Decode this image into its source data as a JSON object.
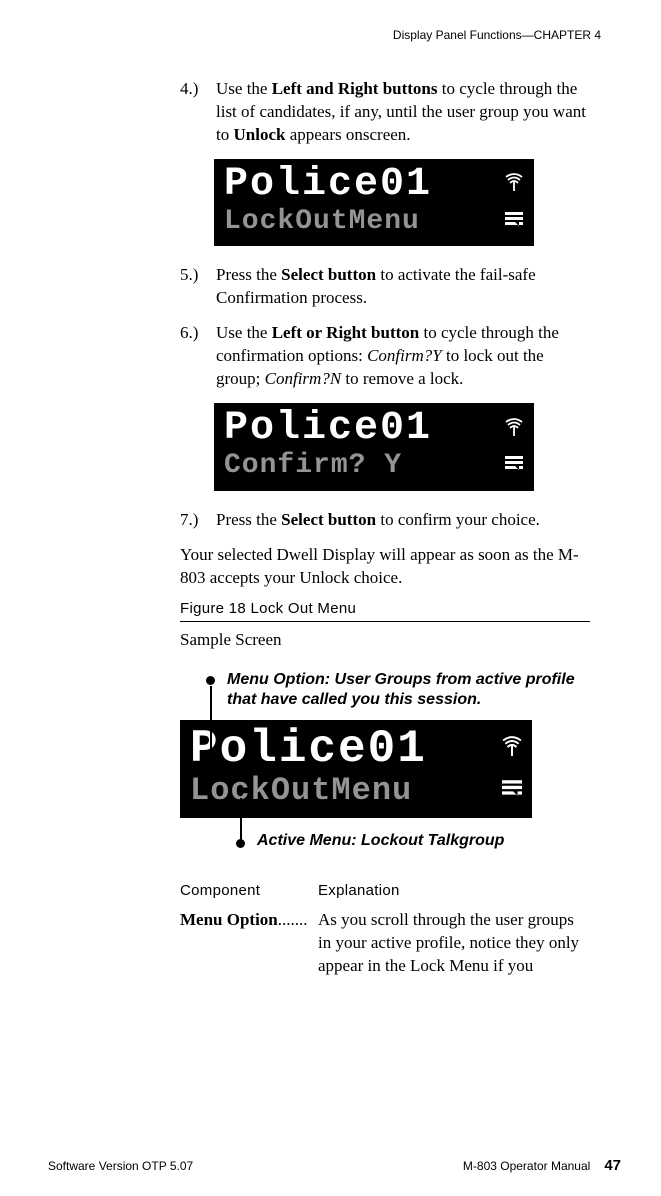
{
  "header": "Display Panel Functions—CHAPTER 4",
  "steps": {
    "s4": {
      "num": "4.)",
      "t1": "Use the ",
      "b1": "Left and Right buttons",
      "t2": " to cycle through the list of candidates, if any, until the user group you want to ",
      "b2": "Unlock",
      "t3": " appears onscreen."
    },
    "s5": {
      "num": "5.)",
      "t1": "Press the ",
      "b1": "Select button",
      "t2": " to activate the fail-safe Confirmation process."
    },
    "s6": {
      "num": "6.)",
      "t1": "Use the ",
      "b1": "Left or Right button",
      "t2": " to cycle through the confirmation options: ",
      "i1": "Confirm?Y",
      "t3": " to lock out the group; ",
      "i2": "Confirm?N",
      "t4": " to remove a lock."
    },
    "s7": {
      "num": "7.)",
      "t1": "Press the ",
      "b1": "Select button",
      "t2": " to confirm your choice."
    }
  },
  "lcd1": {
    "line1": "Police01",
    "line2": "LockOutMenu"
  },
  "lcd2": {
    "line1": "Police01",
    "line2": "Confirm? Y"
  },
  "lcd3": {
    "line1": "Police01",
    "line2": "LockOutMenu"
  },
  "after7": "Your selected Dwell Display will appear as soon as the M-803 accepts your Unlock choice.",
  "figcap": "Figure 18 Lock Out Menu",
  "sample": "Sample Screen",
  "annTop": "Menu Option: User Groups from active profile that have called you this session.",
  "annBottom": "Active Menu: Lockout Talkgroup",
  "compHeader": {
    "a": "Component",
    "b": "Explanation"
  },
  "entry1": {
    "label": "Menu Option",
    "dots": ".......",
    "body": "As you scroll through the user groups in your active profile, notice they only appear in the Lock Menu if you"
  },
  "footer": {
    "left": "Software Version OTP 5.07",
    "center": "M-803 Operator Manual",
    "page": "47"
  }
}
